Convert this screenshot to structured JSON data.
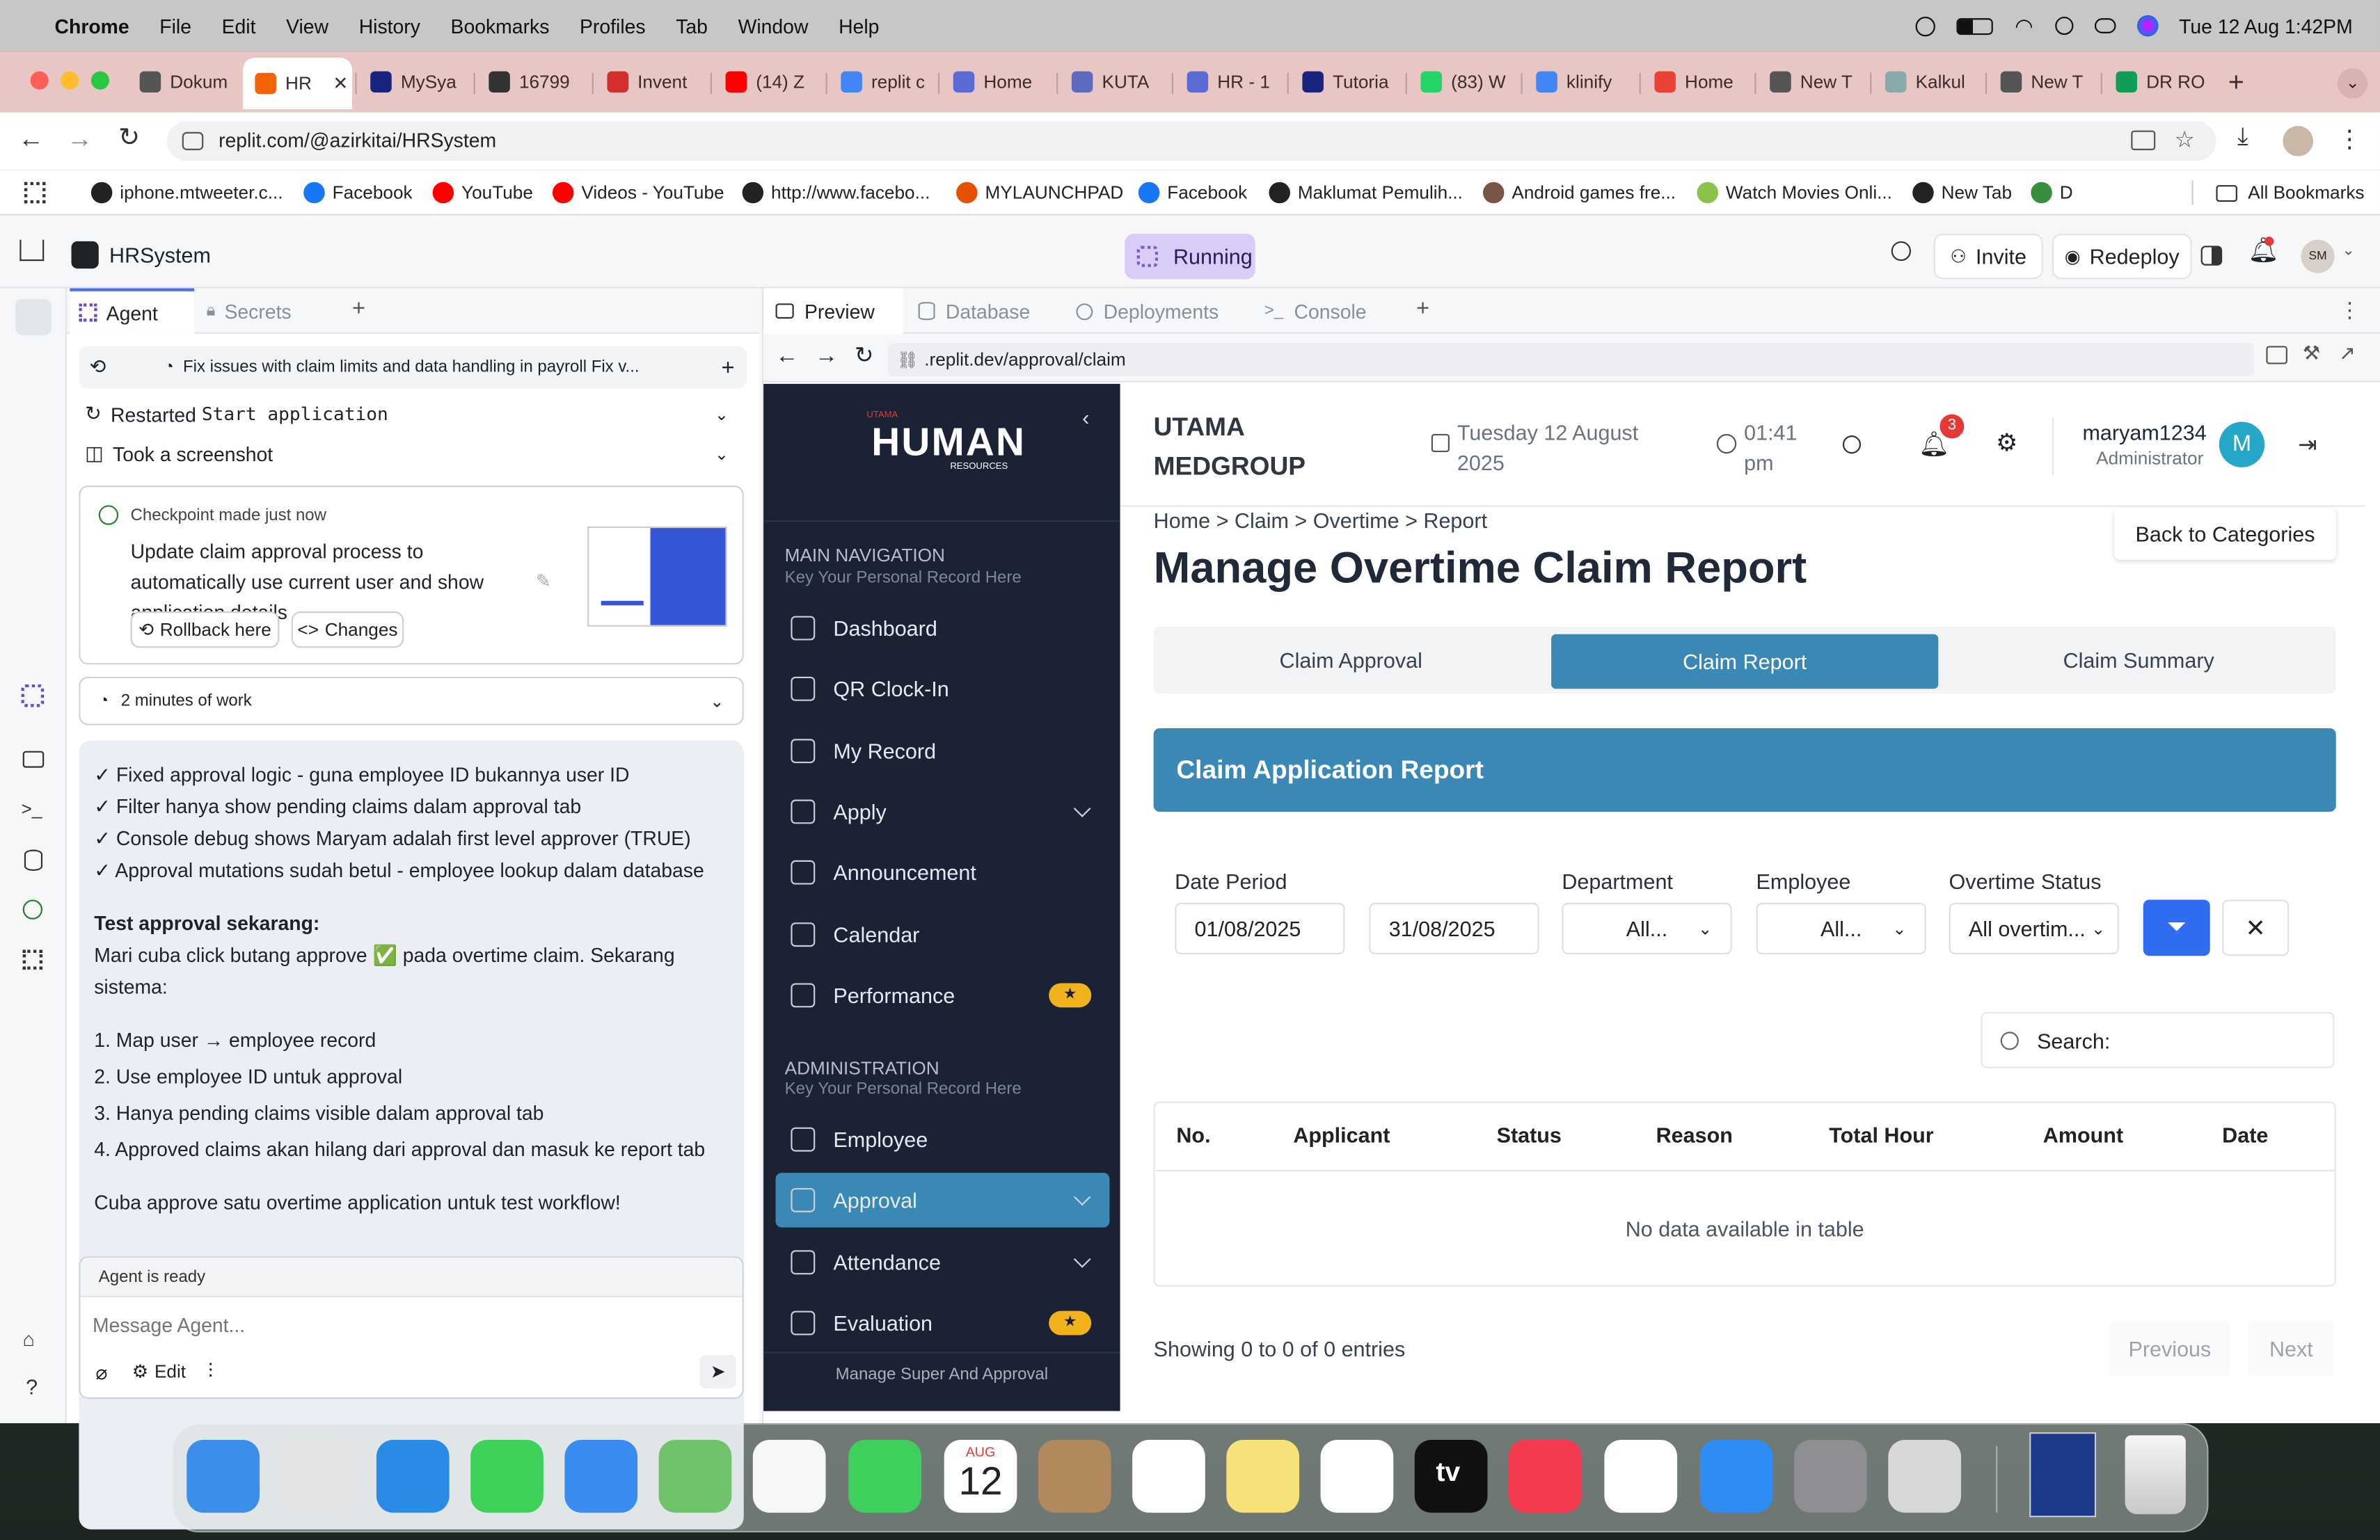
{
  "menubar": {
    "app": "Chrome",
    "items": [
      "File",
      "Edit",
      "View",
      "History",
      "Bookmarks",
      "Profiles",
      "Tab",
      "Window",
      "Help"
    ],
    "datetime": "Tue 12 Aug  1:42PM"
  },
  "tabs": [
    {
      "label": "Dokum",
      "color": "#555"
    },
    {
      "label": "HR",
      "color": "#f26207",
      "active": true
    },
    {
      "label": "MySya",
      "color": "#1a237e"
    },
    {
      "label": "16799",
      "color": "#333"
    },
    {
      "label": "Invent",
      "color": "#d32f2f"
    },
    {
      "label": "(14) Z",
      "color": "#ff0000"
    },
    {
      "label": "replit c",
      "color": "#4285f4"
    },
    {
      "label": "Home",
      "color": "#5b6bd6"
    },
    {
      "label": "KUTA",
      "color": "#5c6bc0"
    },
    {
      "label": "HR - 1",
      "color": "#5b6bd6"
    },
    {
      "label": "Tutoria",
      "color": "#1a237e"
    },
    {
      "label": "(83) W",
      "color": "#25d366"
    },
    {
      "label": "klinify",
      "color": "#4285f4"
    },
    {
      "label": "Home",
      "color": "#ea4335"
    },
    {
      "label": "New T",
      "color": "#555"
    },
    {
      "label": "Kalkul",
      "color": "#8aa"
    },
    {
      "label": "New T",
      "color": "#555"
    },
    {
      "label": "DR RO",
      "color": "#0f9d58"
    }
  ],
  "address": {
    "url": "replit.com/@azirkitai/HRSystem"
  },
  "bookmarks": [
    {
      "label": "iphone.mtweeter.c...",
      "color": "#222"
    },
    {
      "label": "Facebook",
      "color": "#1877f2"
    },
    {
      "label": "YouTube",
      "color": "#ff0000"
    },
    {
      "label": "Videos - YouTube",
      "color": "#ff0000"
    },
    {
      "label": "http://www.facebo...",
      "color": "#222"
    },
    {
      "label": "MYLAUNCHPAD",
      "color": "#e65100"
    },
    {
      "label": "Facebook",
      "color": "#1877f2"
    },
    {
      "label": "Maklumat Pemulih...",
      "color": "#222"
    },
    {
      "label": "Android games fre...",
      "color": "#795548"
    },
    {
      "label": "Watch Movies Onli...",
      "color": "#8bc34a"
    },
    {
      "label": "New Tab",
      "color": "#222"
    },
    {
      "label": "D",
      "color": "#388e3c"
    }
  ],
  "all_bookmarks": "All Bookmarks",
  "replit": {
    "project": "HRSystem",
    "status": "Running",
    "invite": "Invite",
    "redeploy": "Redeploy",
    "avatar": "SM",
    "agent_tabs": [
      "Agent",
      "Secrets"
    ],
    "preview_tabs": [
      "Preview",
      "Database",
      "Deployments",
      "Console"
    ],
    "task_title": "Fix issues with claim limits and data handling in payroll Fix v...",
    "step1_prefix": "Restarted ",
    "step1_code": "Start application",
    "step2": "Took a screenshot",
    "checkpoint_label": "Checkpoint made just now",
    "checkpoint_text": "Update claim approval process to automatically use current user and show application details",
    "rollback": "Rollback here",
    "changes": "Changes",
    "work_time": "2 minutes of work",
    "msg_lines": [
      "✓ Fixed approval logic - guna employee ID bukannya user ID",
      "✓ Filter hanya show pending claims dalam approval tab",
      "✓ Console debug shows Maryam adalah first level approver (TRUE)",
      "✓ Approval mutations sudah betul - employee lookup dalam database"
    ],
    "msg_heading": "Test approval sekarang:",
    "msg_intro": "Mari cuba click butang approve ✅ pada overtime claim. Sekarang sistema:",
    "msg_steps": [
      "1. Map user → employee record",
      "2. Use employee ID untuk approval",
      "3. Hanya pending claims visible dalam approval tab",
      "4. Approved claims akan hilang dari approval dan masuk ke report tab"
    ],
    "msg_outro": "Cuba approve satu overtime application untuk test workflow!",
    "agent_status": "Agent is ready",
    "input_placeholder": "Message Agent...",
    "edit": "Edit",
    "preview_url": ".replit.dev/approval/claim"
  },
  "app": {
    "logo_top": "UTAMA",
    "logo_main": "HUMAN",
    "logo_sub": "RESOURCES",
    "main_nav_title": "MAIN NAVIGATION",
    "main_nav_sub": "Key Your Personal Record Here",
    "nav": [
      {
        "label": "Dashboard"
      },
      {
        "label": "QR Clock-In"
      },
      {
        "label": "My Record"
      },
      {
        "label": "Apply",
        "chevron": true
      },
      {
        "label": "Announcement"
      },
      {
        "label": "Calendar"
      },
      {
        "label": "Performance",
        "star": "★"
      }
    ],
    "admin_title": "ADMINISTRATION",
    "admin_sub": "Key Your Personal Record Here",
    "admin_nav": [
      {
        "label": "Employee"
      },
      {
        "label": "Approval",
        "chevron": true,
        "active": true
      },
      {
        "label": "Attendance",
        "chevron": true
      },
      {
        "label": "Evaluation",
        "star": "★"
      }
    ],
    "sidebar_footer": "Manage Super And Approval",
    "company_line1": "UTAMA",
    "company_line2": "MEDGROUP",
    "date_line1": "Tuesday 12 August",
    "date_line2": "2025",
    "time_line1": "01:41",
    "time_line2": "pm",
    "notif_count": "3",
    "user": "maryam1234",
    "role": "Administrator",
    "user_initial": "M",
    "breadcrumb": "Home > Claim > Overtime > Report",
    "back": "Back to Categories",
    "page_title": "Manage Overtime Claim Report",
    "tabs": [
      "Claim Approval",
      "Claim Report",
      "Claim Summary"
    ],
    "report_title": "Claim Application Report",
    "filters": {
      "date_label": "Date Period",
      "date_from": "01/08/2025",
      "date_to": "31/08/2025",
      "dept_label": "Department",
      "dept_value": "All...",
      "emp_label": "Employee",
      "emp_value": "All...",
      "status_label": "Overtime Status",
      "status_value": "All overtim..."
    },
    "search_label": "Search:",
    "columns": [
      "No.",
      "Applicant",
      "Status",
      "Reason",
      "Total Hour",
      "Amount",
      "Date"
    ],
    "empty": "No data available in table",
    "showing": "Showing 0 to 0 of 0 entries",
    "prev": "Previous",
    "next": "Next"
  },
  "dock_apps": [
    {
      "name": "finder-icon",
      "color": "#3d8ee8"
    },
    {
      "name": "launchpad-icon",
      "color": "#e4e4e4"
    },
    {
      "name": "safari-icon",
      "color": "#2a8be6"
    },
    {
      "name": "messages-icon",
      "color": "#3fd058"
    },
    {
      "name": "mail-icon",
      "color": "#3b8cf0"
    },
    {
      "name": "maps-icon",
      "color": "#6fc36b"
    },
    {
      "name": "photos-icon",
      "color": "#f7f7f7"
    },
    {
      "name": "facetime-icon",
      "color": "#3ecf5c"
    },
    {
      "name": "calendar-icon",
      "color": "#ffffff"
    },
    {
      "name": "contacts-icon",
      "color": "#b08a5c"
    },
    {
      "name": "reminders-icon",
      "color": "#ffffff"
    },
    {
      "name": "notes-icon",
      "color": "#f7e27a"
    },
    {
      "name": "freeform-icon",
      "color": "#ffffff"
    },
    {
      "name": "tv-icon",
      "color": "#111111"
    },
    {
      "name": "music-icon",
      "color": "#f5394f"
    },
    {
      "name": "chrome-icon",
      "color": "#ffffff"
    },
    {
      "name": "app-store-icon",
      "color": "#2e8cf2"
    },
    {
      "name": "settings-icon",
      "color": "#8e8e93"
    },
    {
      "name": "iphone-mirroring-icon",
      "color": "#d8d8d8"
    }
  ],
  "dock_calendar": {
    "month": "AUG",
    "day": "12"
  },
  "dock_tv": "tv"
}
